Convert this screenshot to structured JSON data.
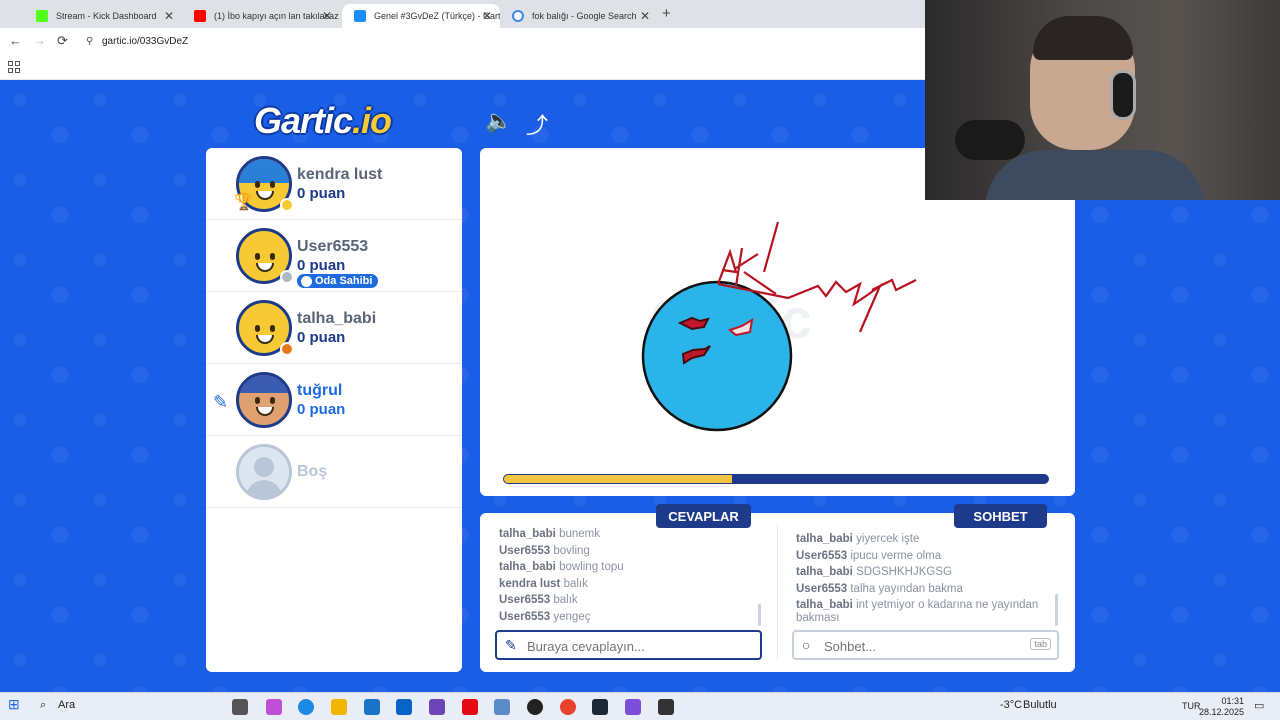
{
  "browser": {
    "tabs": [
      {
        "title": "Stream - Kick Dashboard",
        "color": "#53fc18"
      },
      {
        "title": "(1) İbo kapıyı açın lan takılacaz",
        "color": "#ff0000"
      },
      {
        "title": "Genel #3GvDeZ (Türkçe) - Garti",
        "color": "#1a8cff"
      },
      {
        "title": "fok balığı - Google Search",
        "color": "#4285f4"
      }
    ],
    "tab_close": "✕",
    "new_tab": "+",
    "url": "gartic.io/033GvDeZ",
    "back": "←",
    "forward": "→",
    "reload": "⟳"
  },
  "game": {
    "logo_main": "Gartic",
    "logo_io": ".io",
    "sound_icon": "🔈",
    "share_icon": "⤴",
    "players": [
      {
        "name": "kendra lust",
        "score": "0 puan",
        "dot": "#f7c934",
        "hair": "#2a7fd6",
        "trophy": "🏆"
      },
      {
        "name": "User6553",
        "score": "0 puan",
        "dot": "#b0b8c4",
        "badge": "Oda Sahibi"
      },
      {
        "name": "talha_babi",
        "score": "0 puan",
        "dot": "#e8791a"
      },
      {
        "name": "tuğrul",
        "score": "0 puan",
        "drawing": true,
        "pencil": "✎"
      },
      {
        "name": "Boş",
        "empty": true
      }
    ],
    "progress": 0.42,
    "answers_title": "CEVAPLAR",
    "chat_title": "SOHBET",
    "answers": [
      {
        "user": "talha_babi",
        "text": "bunemk"
      },
      {
        "user": "User6553",
        "text": "bovling"
      },
      {
        "user": "talha_babi",
        "text": "bowling topu"
      },
      {
        "user": "kendra lust",
        "text": "balık"
      },
      {
        "user": "User6553",
        "text": "balık"
      },
      {
        "user": "User6553",
        "text": "yengeç"
      }
    ],
    "chat": [
      {
        "user": "talha_babi",
        "text": "yiyercek işte"
      },
      {
        "user": "User6553",
        "text": "ipucu verme olma"
      },
      {
        "user": "talha_babi",
        "text": "SDGSHKHJKGSG"
      },
      {
        "user": "User6553",
        "text": "talha yayından bakma"
      },
      {
        "user": "talha_babi",
        "text": "int yetmiyor o kadarına ne yayından bakması"
      }
    ],
    "answer_placeholder": "Buraya cevaplayın...",
    "chat_placeholder": "Sohbet...",
    "tab_key": "tab",
    "pencil_icon": "✎",
    "search_icon": "○",
    "drawing_text": "AK"
  },
  "taskbar": {
    "search": "Ara",
    "weather": "-3°C",
    "weather_desc": "Bulutlu",
    "lang": "TUR",
    "time": "01:31",
    "date": "28.12.2025",
    "start_icon": "⊞"
  }
}
